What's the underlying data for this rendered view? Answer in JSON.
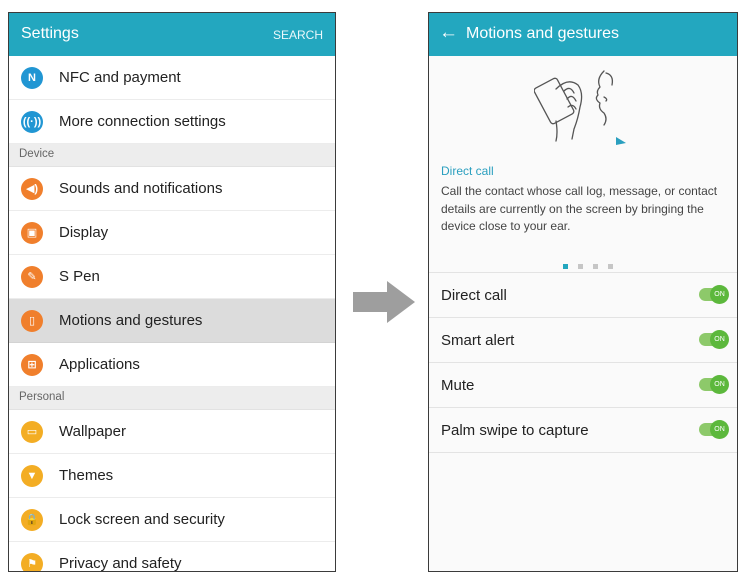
{
  "left_screen": {
    "title": "Settings",
    "action": "SEARCH",
    "rows": [
      {
        "label": "NFC and payment",
        "icon": "nfc-icon",
        "color": "#2196d3"
      },
      {
        "label": "More connection settings",
        "icon": "connection-icon",
        "color": "#2196d3"
      },
      {
        "header": "Device"
      },
      {
        "label": "Sounds and notifications",
        "icon": "speaker-icon",
        "color": "#f07f2c"
      },
      {
        "label": "Display",
        "icon": "display-icon",
        "color": "#f07f2c"
      },
      {
        "label": "S Pen",
        "icon": "pen-icon",
        "color": "#f07f2c"
      },
      {
        "label": "Motions and gestures",
        "icon": "motion-icon",
        "color": "#f07f2c",
        "selected": true
      },
      {
        "label": "Applications",
        "icon": "apps-icon",
        "color": "#f07f2c"
      },
      {
        "header": "Personal"
      },
      {
        "label": "Wallpaper",
        "icon": "wallpaper-icon",
        "color": "#f3ad24"
      },
      {
        "label": "Themes",
        "icon": "themes-icon",
        "color": "#f3ad24"
      },
      {
        "label": "Lock screen and security",
        "icon": "lock-icon",
        "color": "#f3ad24"
      },
      {
        "label": "Privacy and safety",
        "icon": "privacy-icon",
        "color": "#f3ad24"
      }
    ]
  },
  "right_screen": {
    "title": "Motions and gestures",
    "back_icon": "back-arrow-icon",
    "feature_title": "Direct call",
    "feature_description": "Call the contact whose call log, message, or contact details are currently on the screen by bringing the device close to your ear.",
    "toggles": [
      {
        "label": "Direct call",
        "state": "ON"
      },
      {
        "label": "Smart alert",
        "state": "ON"
      },
      {
        "label": "Mute",
        "state": "ON"
      },
      {
        "label": "Palm swipe to capture",
        "state": "ON"
      }
    ]
  },
  "colors": {
    "app_bar": "#23a7bf",
    "switch_on": "#5cb83c",
    "accent_text": "#2a9fbf"
  }
}
